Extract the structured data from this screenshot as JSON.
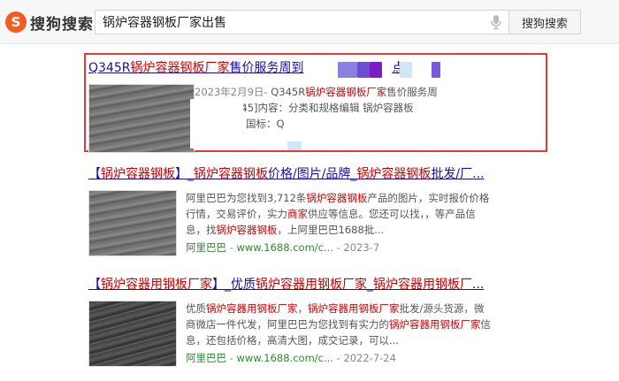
{
  "header": {
    "logo_text": "搜狗搜索",
    "logo_mark": "S",
    "search_value": "锅炉容器钢板厂家出售",
    "search_button": "搜狗搜索"
  },
  "results": [
    {
      "title_pre": "Q345R",
      "title_em": "锅炉容器钢板厂家",
      "title_post": "售价服务周到",
      "title_tail": "点",
      "abstract_line1_date": "2023年2月9日-",
      "abstract_line1_pre": " Q345R",
      "abstract_line1_em": "锅炉容器钢板厂家",
      "abstract_line1_post": "售价服务周",
      "abstract_line2": "e145]内容：分类和规格编辑 锅炉容器板",
      "abstract_line3": "国标：Q"
    },
    {
      "title_parts": [
        {
          "t": "【",
          "em": false
        },
        {
          "t": "锅炉容器钢板",
          "em": true
        },
        {
          "t": "】_",
          "em": false
        },
        {
          "t": "锅炉容器钢板",
          "em": true
        },
        {
          "t": "价格/图片/品牌_",
          "em": false
        },
        {
          "t": "锅炉容器钢板",
          "em": true
        },
        {
          "t": "批发/厂...",
          "em": false
        }
      ],
      "abstract_parts": [
        {
          "t": "阿里巴巴为您找到3,712条",
          "em": false
        },
        {
          "t": "锅炉容器钢板",
          "em": true
        },
        {
          "t": "产品的图片，实时报价价格行情，交易评价，实力",
          "em": false
        },
        {
          "t": "商家",
          "em": true
        },
        {
          "t": "供应等信息。您还可以找，，等产品信息，找",
          "em": false
        },
        {
          "t": "锅炉容器钢板",
          "em": true
        },
        {
          "t": "，上阿里巴巴1688批...",
          "em": false
        }
      ],
      "source": "阿里巴巴",
      "url": "www.1688.com/c...",
      "date": "2023-7"
    },
    {
      "title_parts": [
        {
          "t": "【",
          "em": false
        },
        {
          "t": "锅炉容器用钢板厂家",
          "em": true
        },
        {
          "t": "】_优质",
          "em": false
        },
        {
          "t": "锅炉容器用钢板厂家",
          "em": true
        },
        {
          "t": "_",
          "em": false
        },
        {
          "t": "锅炉容器用钢板厂",
          "em": true
        },
        {
          "t": "...",
          "em": false
        }
      ],
      "abstract_parts": [
        {
          "t": "优质",
          "em": false
        },
        {
          "t": "锅炉容器用钢板厂家",
          "em": true
        },
        {
          "t": "，",
          "em": false
        },
        {
          "t": "锅炉容器用钢板厂家",
          "em": true
        },
        {
          "t": "批发/源头货源，微商微店一件代发，阿里巴巴为您找到有实力的",
          "em": false
        },
        {
          "t": "锅炉容器用钢板厂家",
          "em": true
        },
        {
          "t": "信息，还包括价格，高清大图，成交记录，可以...",
          "em": false
        }
      ],
      "source": "阿里巴巴",
      "url": "www.1688.com/c...",
      "date": "2022-7-24"
    }
  ],
  "colors": {
    "link": "#1a0dab",
    "highlight": "#cc0000",
    "source": "#2e8b2e",
    "annotation_box": "#e13a3a",
    "logo": "#f25d24"
  },
  "icons": [
    "sogou-logo-icon",
    "microphone-icon"
  ]
}
